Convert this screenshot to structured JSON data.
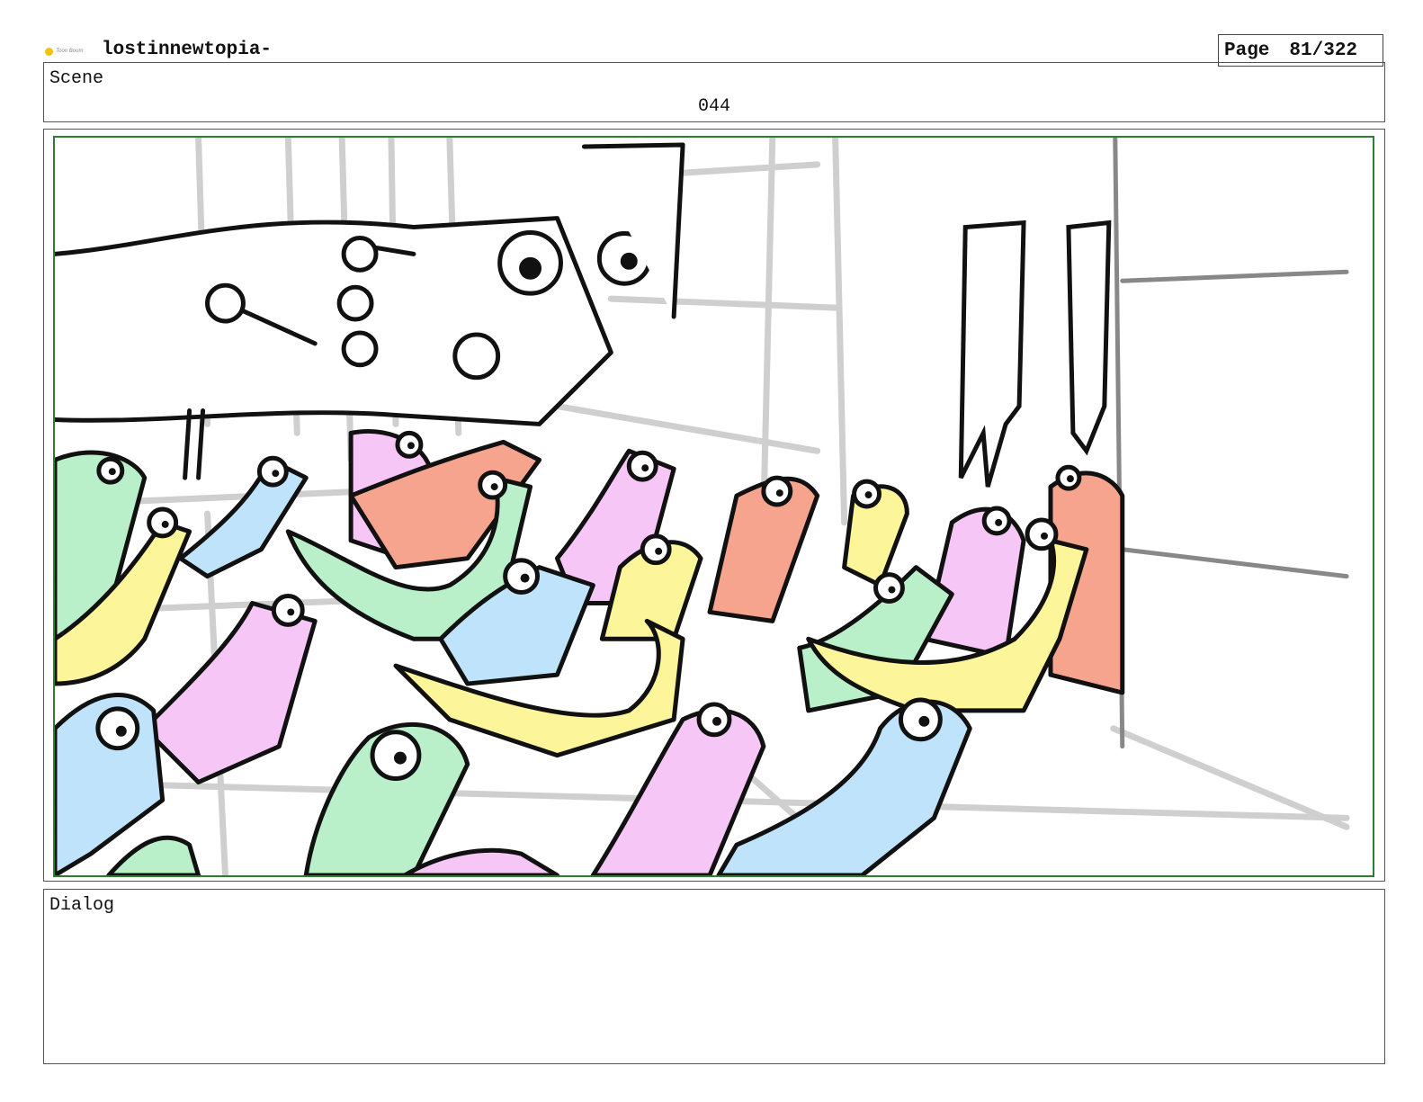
{
  "header": {
    "logo_icon": "toon-boom-logo",
    "logo_text": "Toon Boom",
    "project_title": "lostinnewtopia-",
    "page_label": "Page",
    "page_value": "81/322"
  },
  "scene": {
    "label": "Scene",
    "number": "044"
  },
  "panel": {
    "frame_color": "#2e7d32",
    "creature_colors": [
      "#b9f0c9",
      "#fdf59a",
      "#bfe3fb",
      "#f6c6f7",
      "#f7a48f"
    ]
  },
  "dialog": {
    "label": "Dialog"
  }
}
